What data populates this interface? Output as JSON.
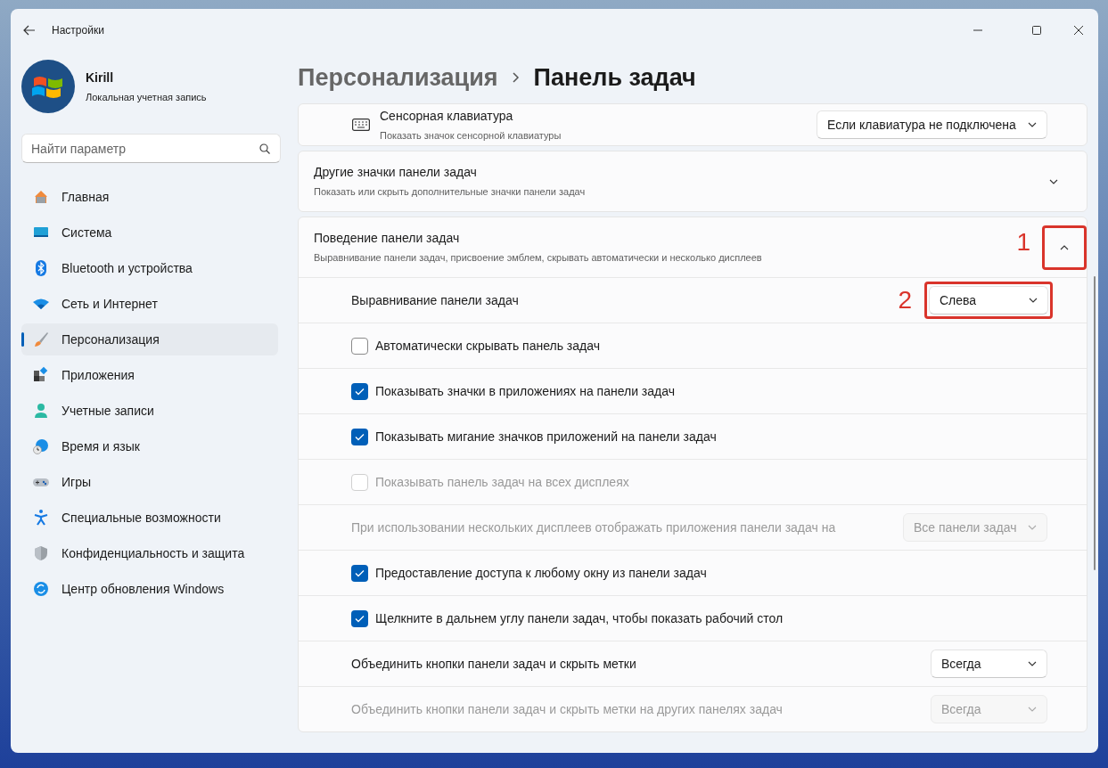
{
  "window": {
    "title": "Настройки"
  },
  "account": {
    "name": "Kirill",
    "type": "Локальная учетная запись"
  },
  "search": {
    "placeholder": "Найти параметр"
  },
  "sidebar": {
    "items": [
      {
        "label": "Главная",
        "selected": false
      },
      {
        "label": "Система",
        "selected": false
      },
      {
        "label": "Bluetooth и устройства",
        "selected": false
      },
      {
        "label": "Сеть и Интернет",
        "selected": false
      },
      {
        "label": "Персонализация",
        "selected": true
      },
      {
        "label": "Приложения",
        "selected": false
      },
      {
        "label": "Учетные записи",
        "selected": false
      },
      {
        "label": "Время и язык",
        "selected": false
      },
      {
        "label": "Игры",
        "selected": false
      },
      {
        "label": "Специальные возможности",
        "selected": false
      },
      {
        "label": "Конфиденциальность и защита",
        "selected": false
      },
      {
        "label": "Центр обновления Windows",
        "selected": false
      }
    ]
  },
  "breadcrumb": [
    {
      "label": "Персонализация"
    },
    {
      "label": "Панель задач"
    }
  ],
  "sections": [
    {
      "kind": "setting",
      "title": "Сенсорная клавиатура",
      "description": "Показать значок сенсорной клавиатуры",
      "dropdown": {
        "value": "Если клавиатура не подключена"
      }
    },
    {
      "kind": "expander",
      "title": "Другие значки панели задач",
      "description": "Показать или скрыть дополнительные значки панели задач",
      "expanded": false
    },
    {
      "kind": "expander",
      "title": "Поведение панели задач",
      "description": "Выравнивание панели задач, присвоение эмблем, скрывать автоматически и несколько дисплеев",
      "expanded": true,
      "callout": "1",
      "rows": [
        {
          "kind": "dropdown",
          "label": "Выравнивание панели задач",
          "value": "Слева",
          "disabled": false,
          "callout": "2"
        },
        {
          "kind": "checkbox",
          "label": "Автоматически скрывать панель задач",
          "checked": false,
          "disabled": false
        },
        {
          "kind": "checkbox",
          "label": "Показывать значки в приложениях на панели задач",
          "checked": true,
          "disabled": false
        },
        {
          "kind": "checkbox",
          "label": "Показывать мигание значков приложений на панели задач",
          "checked": true,
          "disabled": false
        },
        {
          "kind": "checkbox",
          "label": "Показывать панель задач на всех дисплеях",
          "checked": false,
          "disabled": true
        },
        {
          "kind": "dropdown",
          "label": "При использовании нескольких дисплеев отображать приложения панели задач на",
          "value": "Все панели задач",
          "disabled": true
        },
        {
          "kind": "checkbox",
          "label": "Предоставление доступа к любому окну из панели задач",
          "checked": true,
          "disabled": false
        },
        {
          "kind": "checkbox",
          "label": "Щелкните в дальнем углу панели задач, чтобы показать рабочий стол",
          "checked": true,
          "disabled": false
        },
        {
          "kind": "dropdown",
          "label": "Объединить кнопки панели задач и скрыть метки",
          "value": "Всегда",
          "disabled": false
        },
        {
          "kind": "dropdown",
          "label": "Объединить кнопки панели задач и скрыть метки на других панелях задач",
          "value": "Всегда",
          "disabled": true
        }
      ]
    }
  ]
}
